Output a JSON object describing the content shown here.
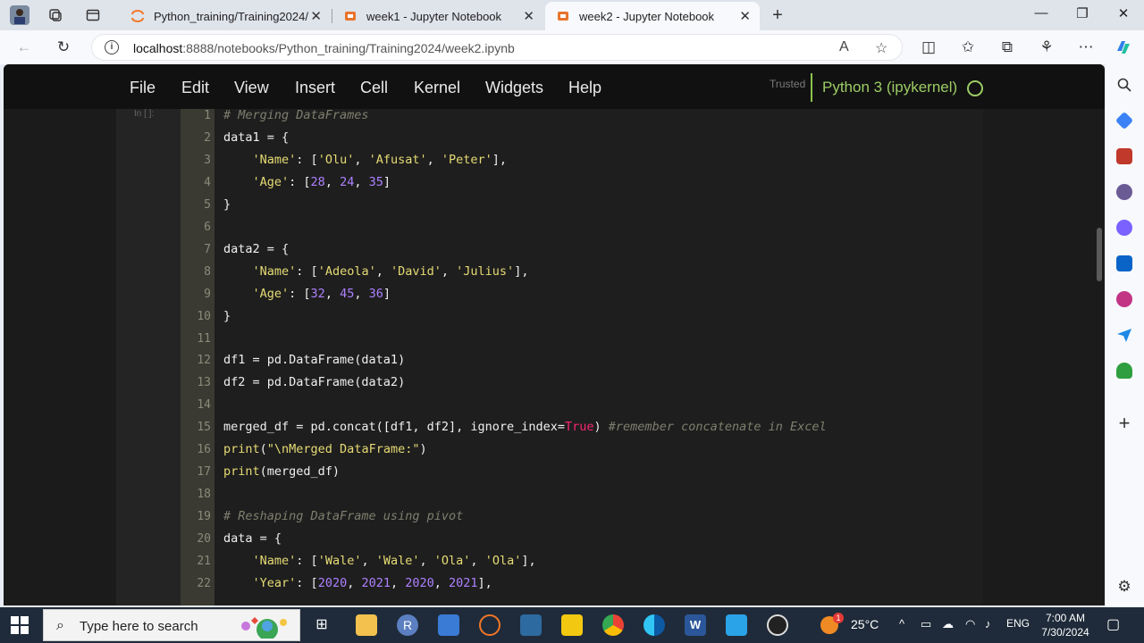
{
  "browser": {
    "tabs": [
      {
        "title": "Python_training/Training2024/",
        "active": false
      },
      {
        "title": "week1 - Jupyter Notebook",
        "active": false
      },
      {
        "title": "week2 - Jupyter Notebook",
        "active": true
      }
    ],
    "url_host": "localhost",
    "url_rest": ":8888/notebooks/Python_training/Training2024/week2.ipynb"
  },
  "jupyter": {
    "menu": [
      "File",
      "Edit",
      "View",
      "Insert",
      "Cell",
      "Kernel",
      "Widgets",
      "Help"
    ],
    "trusted": "Trusted",
    "kernel": "Python 3 (ipykernel)",
    "prompt": "In [ ]:"
  },
  "code_lines": [
    {
      "n": "1",
      "tokens": [
        [
          "c-com",
          "# Merging DataFrames"
        ]
      ]
    },
    {
      "n": "2",
      "tokens": [
        [
          "c-def",
          "data1 = {"
        ]
      ]
    },
    {
      "n": "3",
      "tokens": [
        [
          "c-def",
          "    "
        ],
        [
          "c-str",
          "'Name'"
        ],
        [
          "c-def",
          ": ["
        ],
        [
          "c-str",
          "'Olu'"
        ],
        [
          "c-def",
          ", "
        ],
        [
          "c-str",
          "'Afusat'"
        ],
        [
          "c-def",
          ", "
        ],
        [
          "c-str",
          "'Peter'"
        ],
        [
          "c-def",
          "],"
        ]
      ]
    },
    {
      "n": "4",
      "tokens": [
        [
          "c-def",
          "    "
        ],
        [
          "c-str",
          "'Age'"
        ],
        [
          "c-def",
          ": ["
        ],
        [
          "c-num",
          "28"
        ],
        [
          "c-def",
          ", "
        ],
        [
          "c-num",
          "24"
        ],
        [
          "c-def",
          ", "
        ],
        [
          "c-num",
          "35"
        ],
        [
          "c-def",
          "]"
        ]
      ]
    },
    {
      "n": "5",
      "tokens": [
        [
          "c-def",
          "}"
        ]
      ]
    },
    {
      "n": "6",
      "tokens": []
    },
    {
      "n": "7",
      "tokens": [
        [
          "c-def",
          "data2 = {"
        ]
      ]
    },
    {
      "n": "8",
      "tokens": [
        [
          "c-def",
          "    "
        ],
        [
          "c-str",
          "'Name'"
        ],
        [
          "c-def",
          ": ["
        ],
        [
          "c-str",
          "'Adeola'"
        ],
        [
          "c-def",
          ", "
        ],
        [
          "c-str",
          "'David'"
        ],
        [
          "c-def",
          ", "
        ],
        [
          "c-str",
          "'Julius'"
        ],
        [
          "c-def",
          "],"
        ]
      ]
    },
    {
      "n": "9",
      "tokens": [
        [
          "c-def",
          "    "
        ],
        [
          "c-str",
          "'Age'"
        ],
        [
          "c-def",
          ": ["
        ],
        [
          "c-num",
          "32"
        ],
        [
          "c-def",
          ", "
        ],
        [
          "c-num",
          "45"
        ],
        [
          "c-def",
          ", "
        ],
        [
          "c-num",
          "36"
        ],
        [
          "c-def",
          "]"
        ]
      ]
    },
    {
      "n": "10",
      "tokens": [
        [
          "c-def",
          "}"
        ]
      ]
    },
    {
      "n": "11",
      "tokens": []
    },
    {
      "n": "12",
      "tokens": [
        [
          "c-def",
          "df1 = pd.DataFrame(data1)"
        ]
      ]
    },
    {
      "n": "13",
      "tokens": [
        [
          "c-def",
          "df2 = pd.DataFrame(data2)"
        ]
      ]
    },
    {
      "n": "14",
      "tokens": []
    },
    {
      "n": "15",
      "tokens": [
        [
          "c-def",
          "merged_df = pd.concat([df1, df2], ignore_index="
        ],
        [
          "c-kw",
          "True"
        ],
        [
          "c-def",
          ") "
        ],
        [
          "c-com",
          "#remember concatenate in Excel"
        ]
      ]
    },
    {
      "n": "16",
      "tokens": [
        [
          "c-fn",
          "print"
        ],
        [
          "c-def",
          "("
        ],
        [
          "c-str",
          "\"\\nMerged DataFrame:\""
        ],
        [
          "c-def",
          ")"
        ]
      ]
    },
    {
      "n": "17",
      "tokens": [
        [
          "c-fn",
          "print"
        ],
        [
          "c-def",
          "(merged_df)"
        ]
      ]
    },
    {
      "n": "18",
      "tokens": []
    },
    {
      "n": "19",
      "tokens": [
        [
          "c-com",
          "# Reshaping DataFrame using pivot"
        ]
      ]
    },
    {
      "n": "20",
      "tokens": [
        [
          "c-def",
          "data = {"
        ]
      ]
    },
    {
      "n": "21",
      "tokens": [
        [
          "c-def",
          "    "
        ],
        [
          "c-str",
          "'Name'"
        ],
        [
          "c-def",
          ": ["
        ],
        [
          "c-str",
          "'Wale'"
        ],
        [
          "c-def",
          ", "
        ],
        [
          "c-str",
          "'Wale'"
        ],
        [
          "c-def",
          ", "
        ],
        [
          "c-str",
          "'Ola'"
        ],
        [
          "c-def",
          ", "
        ],
        [
          "c-str",
          "'Ola'"
        ],
        [
          "c-def",
          "],"
        ]
      ]
    },
    {
      "n": "22",
      "tokens": [
        [
          "c-def",
          "    "
        ],
        [
          "c-str",
          "'Year'"
        ],
        [
          "c-def",
          ": ["
        ],
        [
          "c-num",
          "2020"
        ],
        [
          "c-def",
          ", "
        ],
        [
          "c-num",
          "2021"
        ],
        [
          "c-def",
          ", "
        ],
        [
          "c-num",
          "2020"
        ],
        [
          "c-def",
          ", "
        ],
        [
          "c-num",
          "2021"
        ],
        [
          "c-def",
          "],"
        ]
      ]
    }
  ],
  "taskbar": {
    "search_placeholder": "Type here to search",
    "weather": "25°C",
    "lang": "ENG",
    "time": "7:00 AM",
    "date": "7/30/2024",
    "notification_count": "1"
  },
  "colors": {
    "accent_green": "#9ccc65",
    "editor_bg": "#1e1e1e",
    "gutter_bg": "#3a3a32"
  }
}
